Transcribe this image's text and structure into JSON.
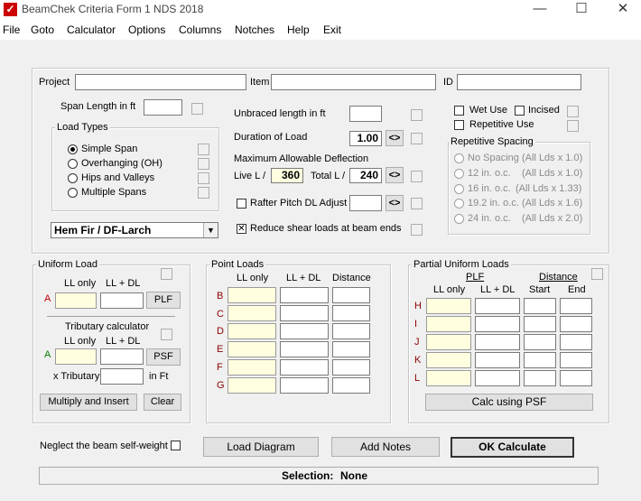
{
  "window": {
    "title": "BeamChek Criteria Form 1  NDS 2018",
    "minimize": "—",
    "maximize": "☐",
    "close": "✕"
  },
  "menu": [
    "File",
    "Goto",
    "Calculator",
    "Options",
    "Columns",
    "Notches",
    "Help",
    "Exit"
  ],
  "project": {
    "project_label": "Project",
    "item_label": "Item",
    "id_label": "ID"
  },
  "span": {
    "label": "Span Length in ft"
  },
  "load_types": {
    "title": "Load Types",
    "options": [
      "Simple Span",
      "Overhanging (OH)",
      "Hips and Valleys",
      "Multiple Spans"
    ],
    "selected": "Simple Span"
  },
  "species": {
    "value": "Hem Fir / DF-Larch"
  },
  "unbraced": {
    "label": "Unbraced length in ft"
  },
  "duration": {
    "label": "Duration of Load",
    "value": "1.00",
    "btn": "<>"
  },
  "deflection": {
    "title": "Maximum Allowable Deflection",
    "live_label": "Live L /",
    "live_value": "360",
    "total_label": "Total L /",
    "total_value": "240",
    "btn": "<>"
  },
  "rafter": {
    "label": "Rafter Pitch DL Adjust",
    "btn": "<>"
  },
  "reduce_shear": {
    "label": "Reduce shear loads at beam ends",
    "checked": "✕"
  },
  "wet_use": {
    "label": "Wet Use"
  },
  "incised": {
    "label": "Incised"
  },
  "repetitive_use": {
    "label": "Repetitive Use"
  },
  "repetitive_spacing": {
    "title": "Repetitive Spacing",
    "options": [
      {
        "label": "No Spacing",
        "note": "(All Lds x 1.0)"
      },
      {
        "label": "12 in. o.c.",
        "note": "(All Lds x 1.0)"
      },
      {
        "label": "16 in. o.c.",
        "note": "(All Lds x 1.33)"
      },
      {
        "label": "19.2 in. o.c.",
        "note": "(All Lds x 1.6)"
      },
      {
        "label": "24 in. o.c.",
        "note": "(All Lds x 2.0)"
      }
    ]
  },
  "uniform": {
    "title": "Uniform Load",
    "ll_only": "LL only",
    "ll_dl": "LL + DL",
    "row_a": "A",
    "plf_btn": "PLF",
    "trib_title": "Tributary calculator",
    "psf_btn": "PSF",
    "x_trib": "x Tributary",
    "in_ft": "in Ft",
    "multiply_btn": "Multiply and Insert",
    "clear_btn": "Clear"
  },
  "point": {
    "title": "Point Loads",
    "ll_only": "LL only",
    "ll_dl": "LL + DL",
    "distance": "Distance",
    "rows": [
      "B",
      "C",
      "D",
      "E",
      "F",
      "G"
    ]
  },
  "partial": {
    "title": "Partial Uniform Loads",
    "plf": "PLF",
    "distance": "Distance",
    "ll_only": "LL only",
    "ll_dl": "LL + DL",
    "start": "Start",
    "end": "End",
    "rows": [
      "H",
      "I",
      "J",
      "K",
      "L"
    ],
    "calc_btn": "Calc using PSF"
  },
  "bottom": {
    "neglect": "Neglect the beam self-weight",
    "load_diagram": "Load Diagram",
    "add_notes": "Add Notes",
    "ok_calc": "OK Calculate"
  },
  "status": {
    "label": "Selection:",
    "value": "None"
  },
  "colors": {
    "yellow_field": "#ffffe0",
    "row_label": "#8b0000"
  }
}
